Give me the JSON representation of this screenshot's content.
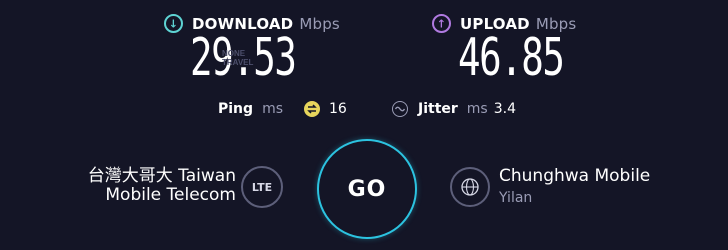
{
  "download": {
    "label": "DOWNLOAD",
    "unit": "Mbps",
    "value": "29.53"
  },
  "upload": {
    "label": "UPLOAD",
    "unit": "Mbps",
    "value": "46.85"
  },
  "watermark": {
    "line1": "NONE",
    "line2": "TRAVEL"
  },
  "ping": {
    "label": "Ping",
    "unit": "ms",
    "value": "16"
  },
  "jitter": {
    "label": "Jitter",
    "unit": "ms",
    "value": "3.4"
  },
  "provider": {
    "line1": "台灣大哥大 Taiwan",
    "line2": "Mobile Telecom",
    "connection": "LTE"
  },
  "go_label": "GO",
  "server": {
    "name": "Chunghwa Mobile",
    "location": "Yilan"
  },
  "colors": {
    "background": "#141526",
    "download_accent": "#5ed3d3",
    "upload_accent": "#b07ae0",
    "ping_accent": "#e7d55c",
    "go_ring": "#2cc3e0"
  }
}
